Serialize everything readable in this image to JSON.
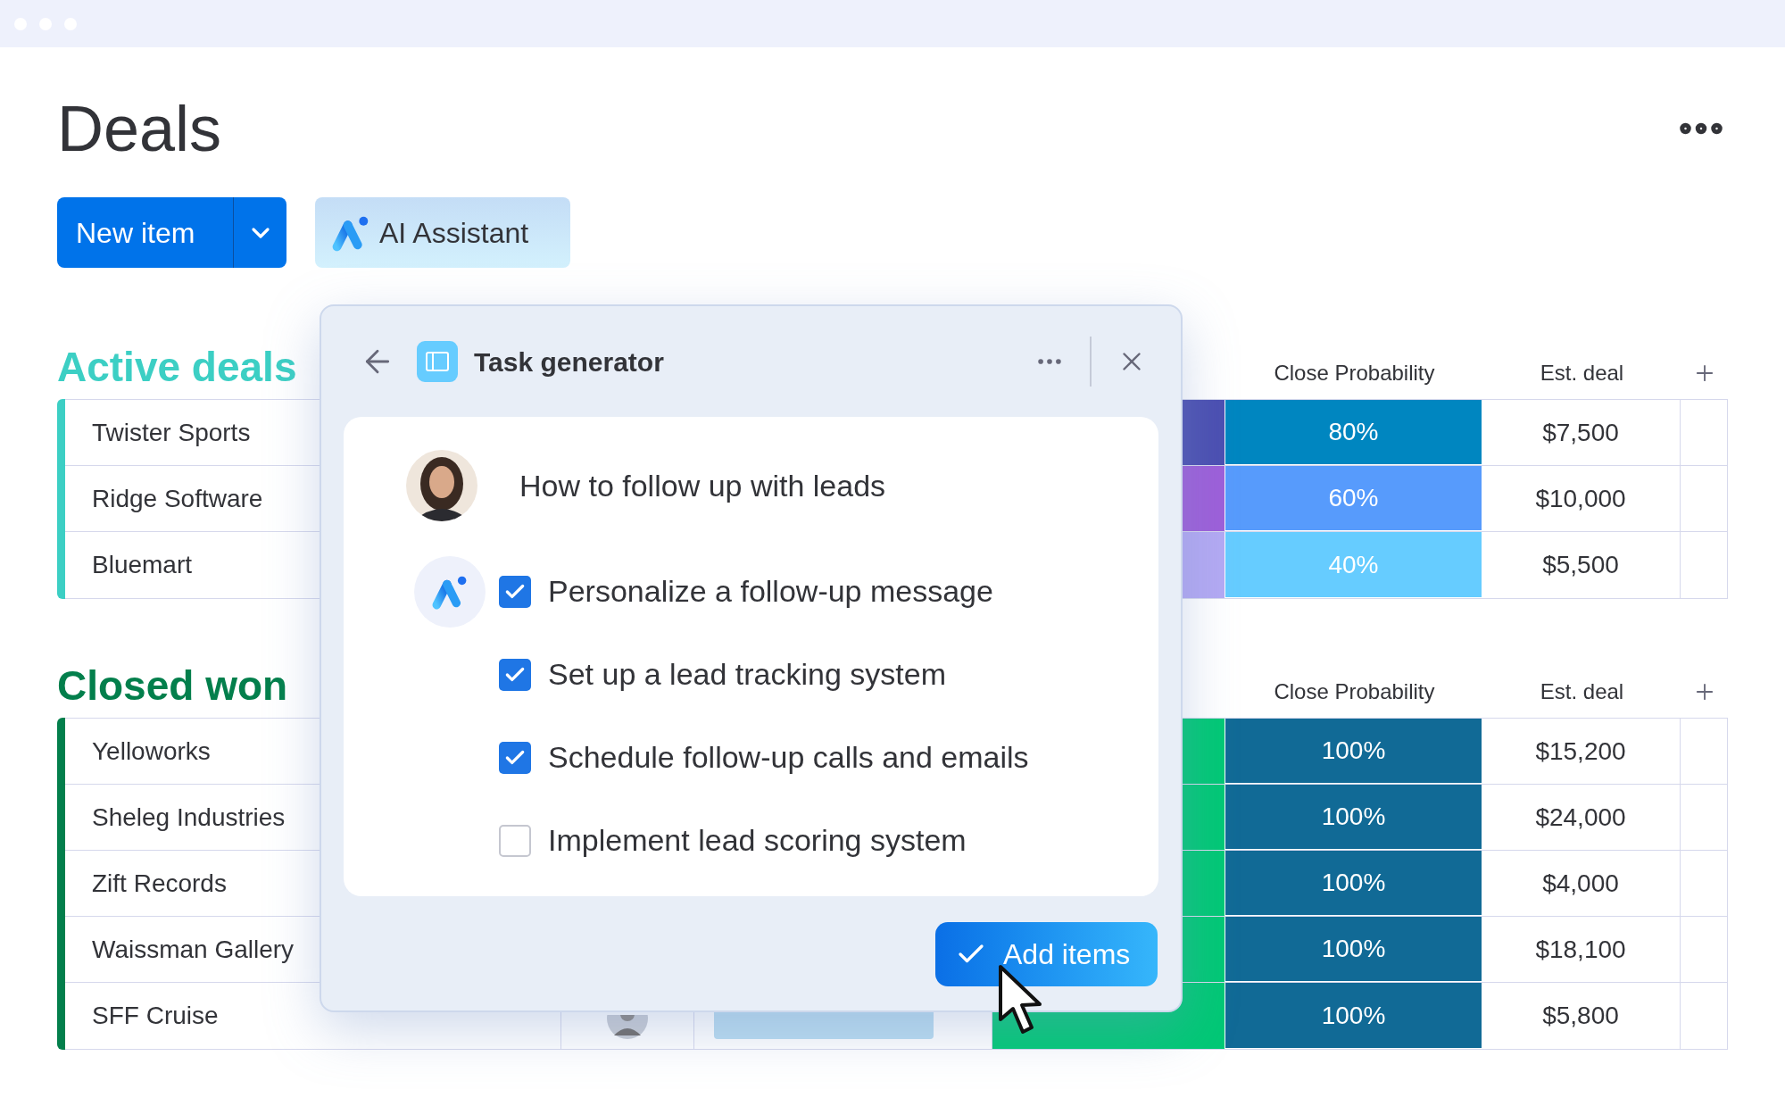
{
  "title": "Deals",
  "toolbar": {
    "new_item": "New item",
    "ai_assistant": "AI Assistant"
  },
  "groups": [
    {
      "title": "Active deals",
      "color": "#3ccfc4",
      "columns": [
        "Close Probability",
        "Est. deal"
      ],
      "rows": [
        {
          "name": "Twister Sports",
          "status": {
            "color": "#4b4fb1"
          },
          "probability": {
            "text": "80%",
            "color": "#0086c0"
          },
          "est_deal": "$7,500"
        },
        {
          "name": "Ridge Software",
          "status": {
            "color": "#9d5fd9"
          },
          "probability": {
            "text": "60%",
            "color": "#579bfc"
          },
          "est_deal": "$10,000"
        },
        {
          "name": "Bluemart",
          "status": {
            "color": "#b3a9f3"
          },
          "probability": {
            "text": "40%",
            "color": "#66ccff"
          },
          "est_deal": "$5,500"
        }
      ]
    },
    {
      "title": "Closed won",
      "color": "#037f4c",
      "columns": [
        "Close Probability",
        "Est. deal"
      ],
      "rows": [
        {
          "name": "Yelloworks",
          "status": {
            "color": "#00c875"
          },
          "probability": {
            "text": "100%",
            "color": "#116a96"
          },
          "est_deal": "$15,200"
        },
        {
          "name": "Sheleg Industries",
          "status": {
            "color": "#00c875"
          },
          "probability": {
            "text": "100%",
            "color": "#116a96"
          },
          "est_deal": "$24,000"
        },
        {
          "name": "Zift Records",
          "status": {
            "color": "#00c875"
          },
          "probability": {
            "text": "100%",
            "color": "#116a96"
          },
          "est_deal": "$4,000"
        },
        {
          "name": "Waissman Gallery",
          "status": {
            "color": "#00c875"
          },
          "probability": {
            "text": "100%",
            "color": "#116a96"
          },
          "est_deal": "$18,100"
        },
        {
          "name": "SFF Cruise",
          "assigned": true,
          "status": {
            "color": "#00c875"
          },
          "probability": {
            "text": "100%",
            "color": "#116a96"
          },
          "est_deal": "$5,800"
        }
      ]
    }
  ],
  "task_generator": {
    "title": "Task generator",
    "prompt": "How to follow up with leads",
    "tasks": [
      {
        "label": "Personalize a follow-up message",
        "checked": true
      },
      {
        "label": "Set up a lead tracking system",
        "checked": true
      },
      {
        "label": "Schedule follow-up calls and emails",
        "checked": true
      },
      {
        "label": "Implement lead scoring system",
        "checked": false
      }
    ],
    "add_button": "Add items"
  }
}
